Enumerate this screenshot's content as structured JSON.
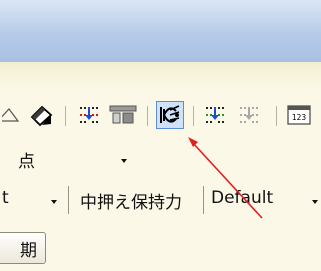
{
  "toolbar": {
    "icons": [
      "triangle-icon",
      "bucket-fill-icon",
      "gallery-dot-grid-icon",
      "object-shelf-icon",
      "fitting-pipe-active-icon",
      "gallery-dot-grid-icon",
      "gallery-dot-grid-disabled-icon",
      "numbered-page-icon"
    ],
    "page_icon_text": "123"
  },
  "row1": {
    "value": "点"
  },
  "row2": {
    "left_value": "t",
    "label": "中押え保持力",
    "value": "Default"
  },
  "button": {
    "label": "期"
  },
  "colors": {
    "title_gradient_top": "#dbe6f4",
    "title_gradient_bottom": "#a9c0e2",
    "panel_bg": "#fbf8e8",
    "active_button_border": "#5b8fd1",
    "active_button_bg": "#cfe2fa",
    "arrow": "#e02020"
  }
}
